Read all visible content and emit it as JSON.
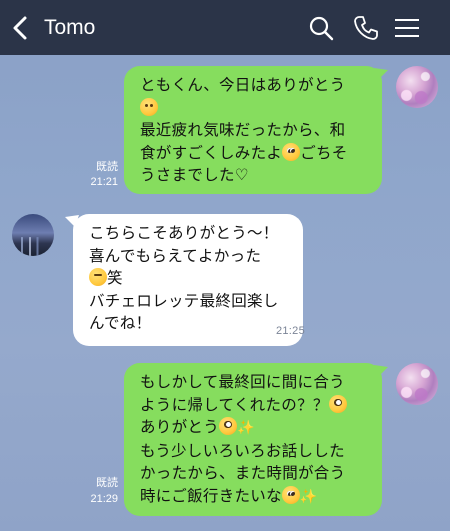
{
  "header": {
    "title": "Tomo",
    "background": "#2b3448",
    "icons": [
      "chevron-left-icon",
      "search-icon",
      "phone-icon",
      "menu-icon"
    ]
  },
  "colors": {
    "outgoing_bubble": "#86dd5e",
    "incoming_bubble": "#ffffff"
  },
  "messages": [
    {
      "from": "me",
      "lines": [
        "ともくん、今日はありがとう",
        "",
        "最近疲れ気味だったから、和",
        "食がすごくしみたよ",
        "うさまでした♡"
      ],
      "line2_emoji": "relieved-face-emoji",
      "line4_suffix": "ごちそ",
      "line4_emoji": "pleading-face-emoji",
      "read": "既読",
      "time": "21:21"
    },
    {
      "from": "Tomo",
      "lines": [
        "こちらこそありがとう〜！",
        "喜んでもらえてよかった",
        "笑",
        "バチェロレッテ最終回楽し",
        "んでね！"
      ],
      "line3_emoji": "smirking-face-emoji",
      "time": "21:25"
    },
    {
      "from": "me",
      "lines": [
        "もしかして最終回に間に合う",
        "ように帰してくれたの？？",
        "ありがとう",
        "もう少しいろいろお話しした",
        "かったから、また時間が合う",
        "時にご飯行きたいな"
      ],
      "line2_emoji": "flushed-face-emoji",
      "line3_emoji": "flushed-face-emoji",
      "line6_emoji": "pleading-face-emoji",
      "read": "既読",
      "time": "21:29"
    }
  ]
}
